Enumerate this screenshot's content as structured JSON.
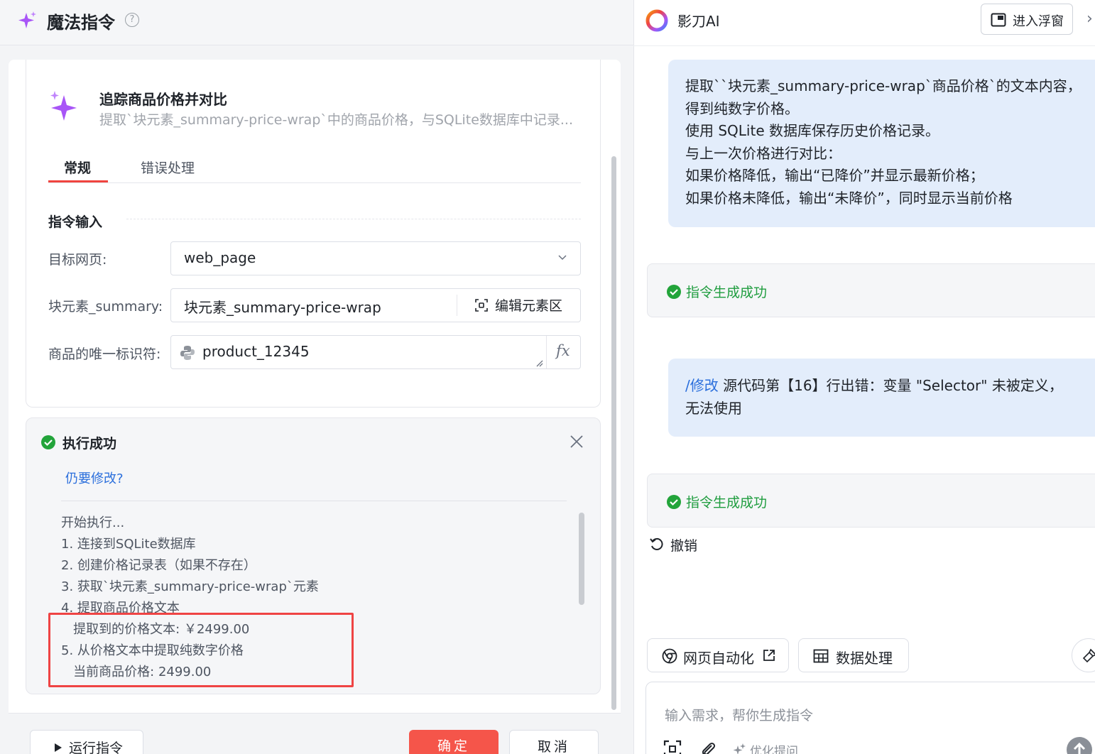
{
  "header": {
    "title": "魔法指令",
    "help": "?"
  },
  "instruction": {
    "title": "追踪商品价格并对比",
    "subtitle": "提取`块元素_summary-price-wrap`中的商品价格，与SQLite数据库中记录..."
  },
  "tabs": [
    {
      "label": "常规",
      "active": true
    },
    {
      "label": "错误处理",
      "active": false
    }
  ],
  "form": {
    "section_title": "指令输入",
    "target_label": "目标网页:",
    "target_value": "web_page",
    "block_label": "块元素_summary:",
    "block_value": "块元素_summary-price-wrap",
    "block_edit": "编辑元素区",
    "id_label": "商品的唯一标识符:",
    "id_value": "product_12345",
    "fx": "fx"
  },
  "result": {
    "title": "执行成功",
    "modify_link": "仍要修改?",
    "log": [
      "开始执行...",
      "1. 连接到SQLite数据库",
      "2. 创建价格记录表（如果不存在）",
      "3. 获取`块元素_summary-price-wrap`元素",
      "4. 提取商品价格文本",
      "   提取到的价格文本: ￥2499.00",
      "5. 从价格文本中提取纯数字价格",
      "   当前商品价格: 2499.00"
    ]
  },
  "footer": {
    "run": "运行指令",
    "ok": "确定",
    "cancel": "取消"
  },
  "ai": {
    "name": "影刀AI",
    "float_button": "进入浮窗",
    "close": "›",
    "message1": [
      "提取``块元素_summary-price-wrap`商品价格`的文本内容，",
      "得到纯数字价格。",
      "使用 SQLite 数据库保存历史价格记录。",
      "与上一次价格进行对比：",
      "如果价格降低，输出“已降价”并显示最新价格；",
      "如果价格未降低，输出“未降价”，同时显示当前价格"
    ],
    "status1": "指令生成成功",
    "message2_cmd": "/修改",
    "message2_line1": " 源代码第【16】行出错：变量 \"Selector\" 未被定义，",
    "message2_line2": "无法使用",
    "status2": "指令生成成功",
    "undo": "撤销",
    "chips": {
      "web": "网页自动化",
      "data": "数据处理"
    },
    "input_placeholder": "输入需求，帮你生成指令",
    "optimize": "优化提问"
  },
  "colors": {
    "accent_red": "#f5554a",
    "success_green": "#1f9d3f",
    "link_blue": "#2b6fdc",
    "bubble_bg": "#e3edfb"
  }
}
